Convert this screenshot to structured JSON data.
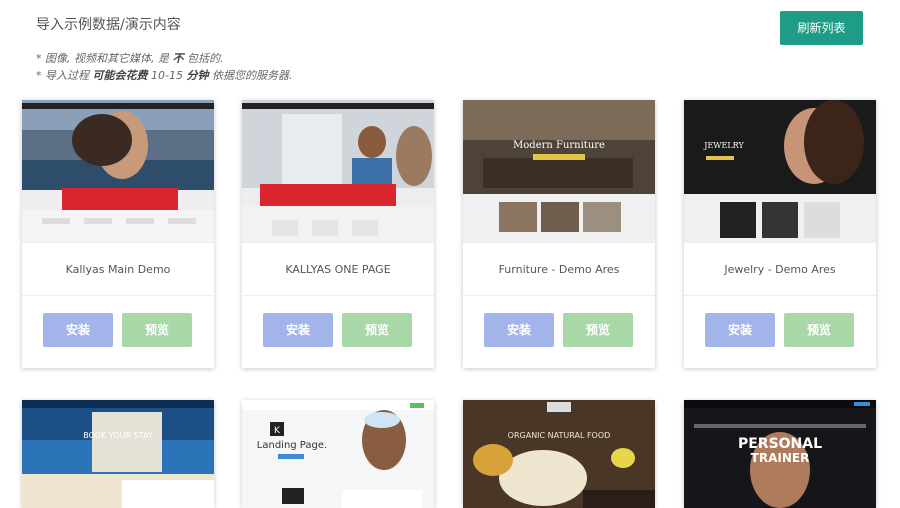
{
  "header": {
    "title": "导入示例数据/演示内容",
    "refresh_label": "刷新列表"
  },
  "notes": {
    "line1_prefix": "* 图像, 视频和其它媒体, 是 ",
    "line1_bold": "不",
    "line1_suffix": " 包括的.",
    "line2_prefix": "* 导入过程 ",
    "line2_bold1": "可能会花费",
    "line2_mid": " 10-15 ",
    "line2_bold2": "分钟",
    "line2_suffix": " 依据您的服务器."
  },
  "buttons": {
    "install": "安装",
    "preview": "预览"
  },
  "demos": [
    {
      "title": "Kallyas Main Demo",
      "thumb": {
        "hero_text": "",
        "sub_text": ""
      }
    },
    {
      "title": "KALLYAS ONE PAGE",
      "thumb": {
        "hero_text": "",
        "sub_text": ""
      }
    },
    {
      "title": "Furniture - Demo Ares",
      "thumb": {
        "hero_text": "Modern Furniture",
        "sub_text": ""
      }
    },
    {
      "title": "Jewelry - Demo Ares",
      "thumb": {
        "hero_text": "JEWELRY",
        "sub_text": ""
      }
    },
    {
      "title": "",
      "thumb": {
        "hero_text": "BOOK YOUR STAY",
        "sub_text": ""
      }
    },
    {
      "title": "",
      "thumb": {
        "hero_text": "Landing Page.",
        "sub_text": "K"
      }
    },
    {
      "title": "",
      "thumb": {
        "hero_text": "ORGANIC NATURAL FOOD",
        "sub_text": ""
      }
    },
    {
      "title": "",
      "thumb": {
        "hero_text": "PERSONAL",
        "sub_text": "TRAINER"
      }
    }
  ]
}
